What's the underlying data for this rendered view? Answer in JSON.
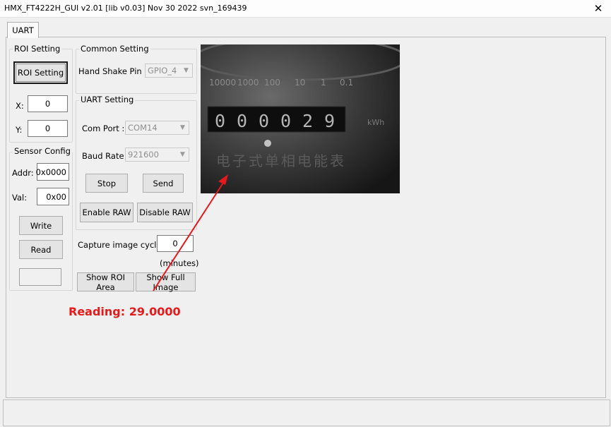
{
  "window": {
    "title": "HMX_FT4222H_GUI v2.01 [lib v0.03] Nov 30 2022 svn_169439",
    "close_glyph": "✕"
  },
  "tabs": [
    {
      "label": "UART"
    }
  ],
  "roi": {
    "group_label": "ROI Setting",
    "button_label": "ROI Setting",
    "x_label": "X:",
    "x_value": "0",
    "y_label": "Y:",
    "y_value": "0"
  },
  "sensor": {
    "group_label": "Sensor Config",
    "addr_label": "Addr:",
    "addr_value": "0x0000",
    "val_label": "Val:",
    "val_value": "0x00",
    "write_label": "Write",
    "read_label": "Read",
    "output_value": ""
  },
  "common": {
    "group_label": "Common Setting",
    "handshake_label": "Hand Shake Pin :",
    "handshake_value": "GPIO_4"
  },
  "uart": {
    "group_label": "UART Setting",
    "com_label": "Com Port :",
    "com_value": "COM14",
    "baud_label": "Baud Rate",
    "baud_value": "921600",
    "stop_label": "Stop",
    "send_label": "Send",
    "enable_raw_label": "Enable RAW",
    "disable_raw_label": "Disable RAW"
  },
  "capture": {
    "label": "Capture image cycle:",
    "value": "0",
    "unit": "(minutes)"
  },
  "view": {
    "show_roi_label": "Show ROI Area",
    "show_full_label": "Show Full Image"
  },
  "meter_image": {
    "scale_labels": [
      "10000",
      "1000",
      "100",
      "10",
      "1",
      "0.1"
    ],
    "digits": [
      "0",
      "0",
      "0",
      "0",
      "2",
      "9"
    ],
    "unit": "kWh",
    "chinese_text": "电子式单相电能表"
  },
  "annotation": {
    "reading_text": "Reading: 29.0000",
    "arrow_color": "#e51a1a"
  }
}
